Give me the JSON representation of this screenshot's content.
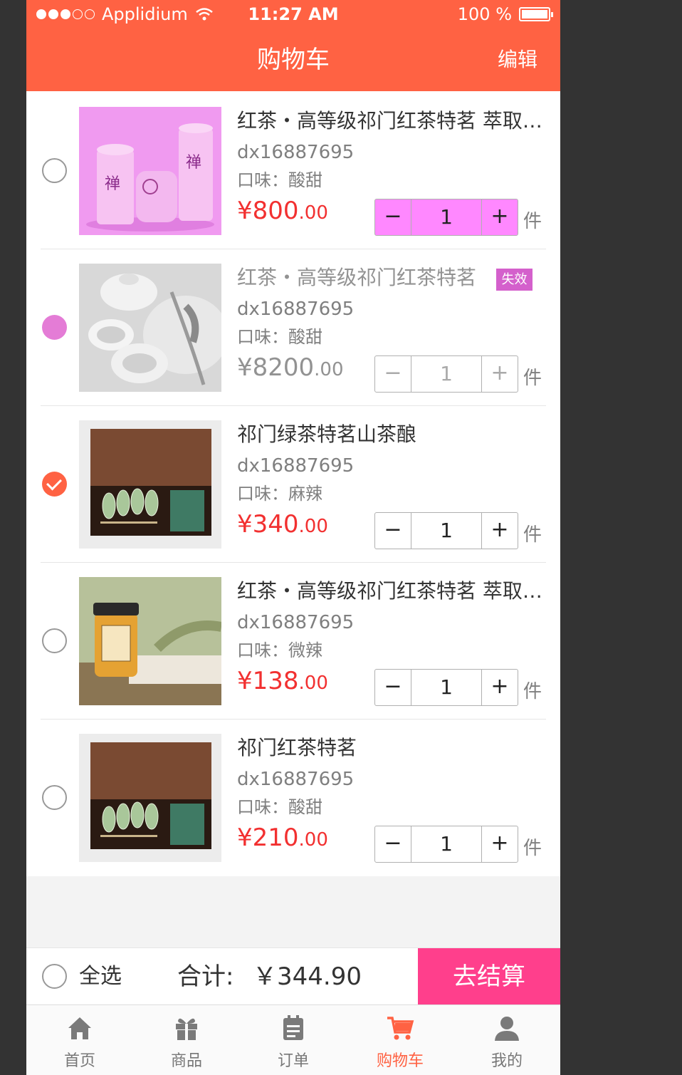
{
  "status": {
    "carrier": "Applidium",
    "time": "11:27 AM",
    "battery": "100 %"
  },
  "header": {
    "title": "购物车",
    "edit_label": "编辑",
    "color": "#ff6243"
  },
  "items": [
    {
      "name": "红茶・高等级祁门红茶特茗 萃取精华",
      "code": "dx16887695",
      "flavor": "口味：酸甜",
      "price_int": "¥800",
      "price_dec": ".00",
      "qty": "1",
      "unit": "件",
      "state": "unchecked",
      "image": "pink-tea-cans"
    },
    {
      "name": "红茶・高等级祁门红茶特茗",
      "code": "dx16887695",
      "flavor": "口味：酸甜",
      "price_int": "¥8200",
      "price_dec": ".00",
      "qty": "1",
      "unit": "件",
      "state": "invalid",
      "tag": "失效",
      "image": "grey-teapot"
    },
    {
      "name": "祁门绿茶特茗山茶酿",
      "code": "dx16887695",
      "flavor": "口味：麻辣",
      "price_int": "¥340",
      "price_dec": ".00",
      "qty": "1",
      "unit": "件",
      "state": "checked",
      "image": "leaf-gift-box"
    },
    {
      "name": "红茶・高等级祁门红茶特茗 萃取精华",
      "code": "dx16887695",
      "flavor": "口味：微辣",
      "price_int": "¥138",
      "price_dec": ".00",
      "qty": "1",
      "unit": "件",
      "state": "unchecked",
      "image": "honey-jar"
    },
    {
      "name": "祁门红茶特茗",
      "code": "dx16887695",
      "flavor": "口味：酸甜",
      "price_int": "¥210",
      "price_dec": ".00",
      "qty": "1",
      "unit": "件",
      "state": "unchecked",
      "image": "leaf-gift-box"
    }
  ],
  "stepper": {
    "minus": "−",
    "plus": "+"
  },
  "checkout": {
    "select_all": "全选",
    "total_label": "合计:",
    "total_value": "￥344.90",
    "go_label": "去结算",
    "go_color": "#ff3f8c"
  },
  "tabs": [
    {
      "label": "首页",
      "icon": "home-icon"
    },
    {
      "label": "商品",
      "icon": "gift-icon"
    },
    {
      "label": "订单",
      "icon": "clipboard-icon"
    },
    {
      "label": "购物车",
      "icon": "cart-icon",
      "active": true
    },
    {
      "label": "我的",
      "icon": "user-icon"
    }
  ]
}
